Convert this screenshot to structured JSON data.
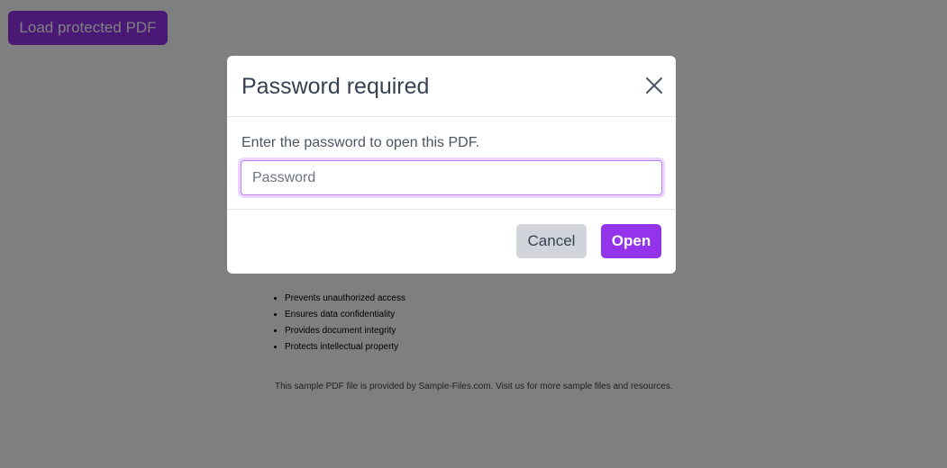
{
  "toolbar": {
    "load_label": "Load protected PDF"
  },
  "pdf": {
    "bullets": [
      "Prevents unauthorized access",
      "Ensures data confidentiality",
      "Provides document integrity",
      "Protects intellectual property"
    ],
    "footer": "This sample PDF file is provided by Sample-Files.com. Visit us for more sample files and resources."
  },
  "dialog": {
    "title": "Password required",
    "message": "Enter the password to open this PDF.",
    "password_placeholder": "Password",
    "password_value": "",
    "cancel_label": "Cancel",
    "open_label": "Open",
    "close_icon": "close-icon"
  },
  "colors": {
    "accent": "#9333ea",
    "overlay": "rgba(0,0,0,0.5)",
    "cancel_bg": "#d1d5db",
    "input_focus_ring": "#e9d5ff"
  }
}
